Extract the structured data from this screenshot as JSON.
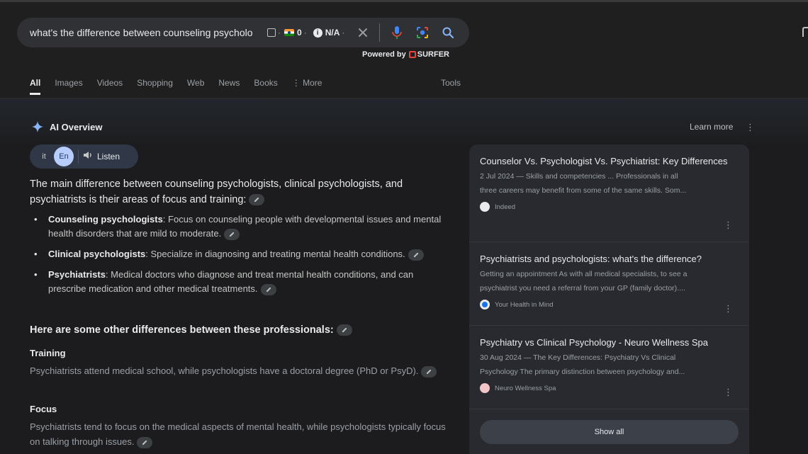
{
  "search": {
    "query": "what's the difference between counseling psycholo",
    "ext_flag_value": "0",
    "ext_na_value": "N/A",
    "powered_by": "Powered by",
    "powered_brand": "SURFER"
  },
  "tabs": [
    {
      "label": "All",
      "active": true
    },
    {
      "label": "Images"
    },
    {
      "label": "Videos"
    },
    {
      "label": "Shopping"
    },
    {
      "label": "Web"
    },
    {
      "label": "News"
    },
    {
      "label": "Books"
    },
    {
      "label": "⋮ More"
    }
  ],
  "tools_label": "Tools",
  "ai_overview": {
    "title": "AI Overview",
    "learn_more": "Learn more",
    "lang_options": [
      "it",
      "En"
    ],
    "listen_label": "Listen",
    "lead": "The main difference between counseling psychologists, clinical psychologists, and psychiatrists is their areas of focus and training:",
    "bullets": [
      {
        "term": "Counseling psychologists",
        "text": ": Focus on counseling people with developmental issues and mental health disorders that are mild to moderate."
      },
      {
        "term": "Clinical psychologists",
        "text": ": Specialize in diagnosing and treating mental health conditions."
      },
      {
        "term": "Psychiatrists",
        "text": ": Medical doctors who diagnose and treat mental health conditions, and can prescribe medication and other medical treatments."
      }
    ],
    "subhead": "Here are some other differences between these professionals:",
    "sections": [
      {
        "title": "Training",
        "body": "Psychiatrists attend medical school, while psychologists have a doctoral degree (PhD or PsyD)."
      },
      {
        "title": "Focus",
        "body": "Psychiatrists tend to focus on the medical aspects of mental health, while psychologists typically focus on talking through issues."
      }
    ]
  },
  "sources": [
    {
      "title": "Counselor Vs. Psychologist Vs. Psychiatrist: Key Differences",
      "snippet1": "2 Jul 2024 — Skills and competencies ... Professionals in all",
      "snippet2": "three careers may benefit from some of the same skills. Som...",
      "site": "Indeed",
      "icon_color": "#e8eaed"
    },
    {
      "title": "Psychiatrists and psychologists: what's the difference?",
      "snippet1": "Getting an appointment As with all medical specialists, to see a",
      "snippet2": "psychiatrist you need a referral from your GP (family doctor)....",
      "site": "Your Health in Mind",
      "icon_color": "#1a73e8"
    },
    {
      "title": "Psychiatry vs Clinical Psychology - Neuro Wellness Spa",
      "snippet1": "30 Aug 2024 — The Key Differences: Psychiatry Vs Clinical",
      "snippet2": "Psychology The primary distinction between psychology and...",
      "site": "Neuro Wellness Spa",
      "icon_color": "#f2c6c6"
    }
  ],
  "show_all_label": "Show all"
}
